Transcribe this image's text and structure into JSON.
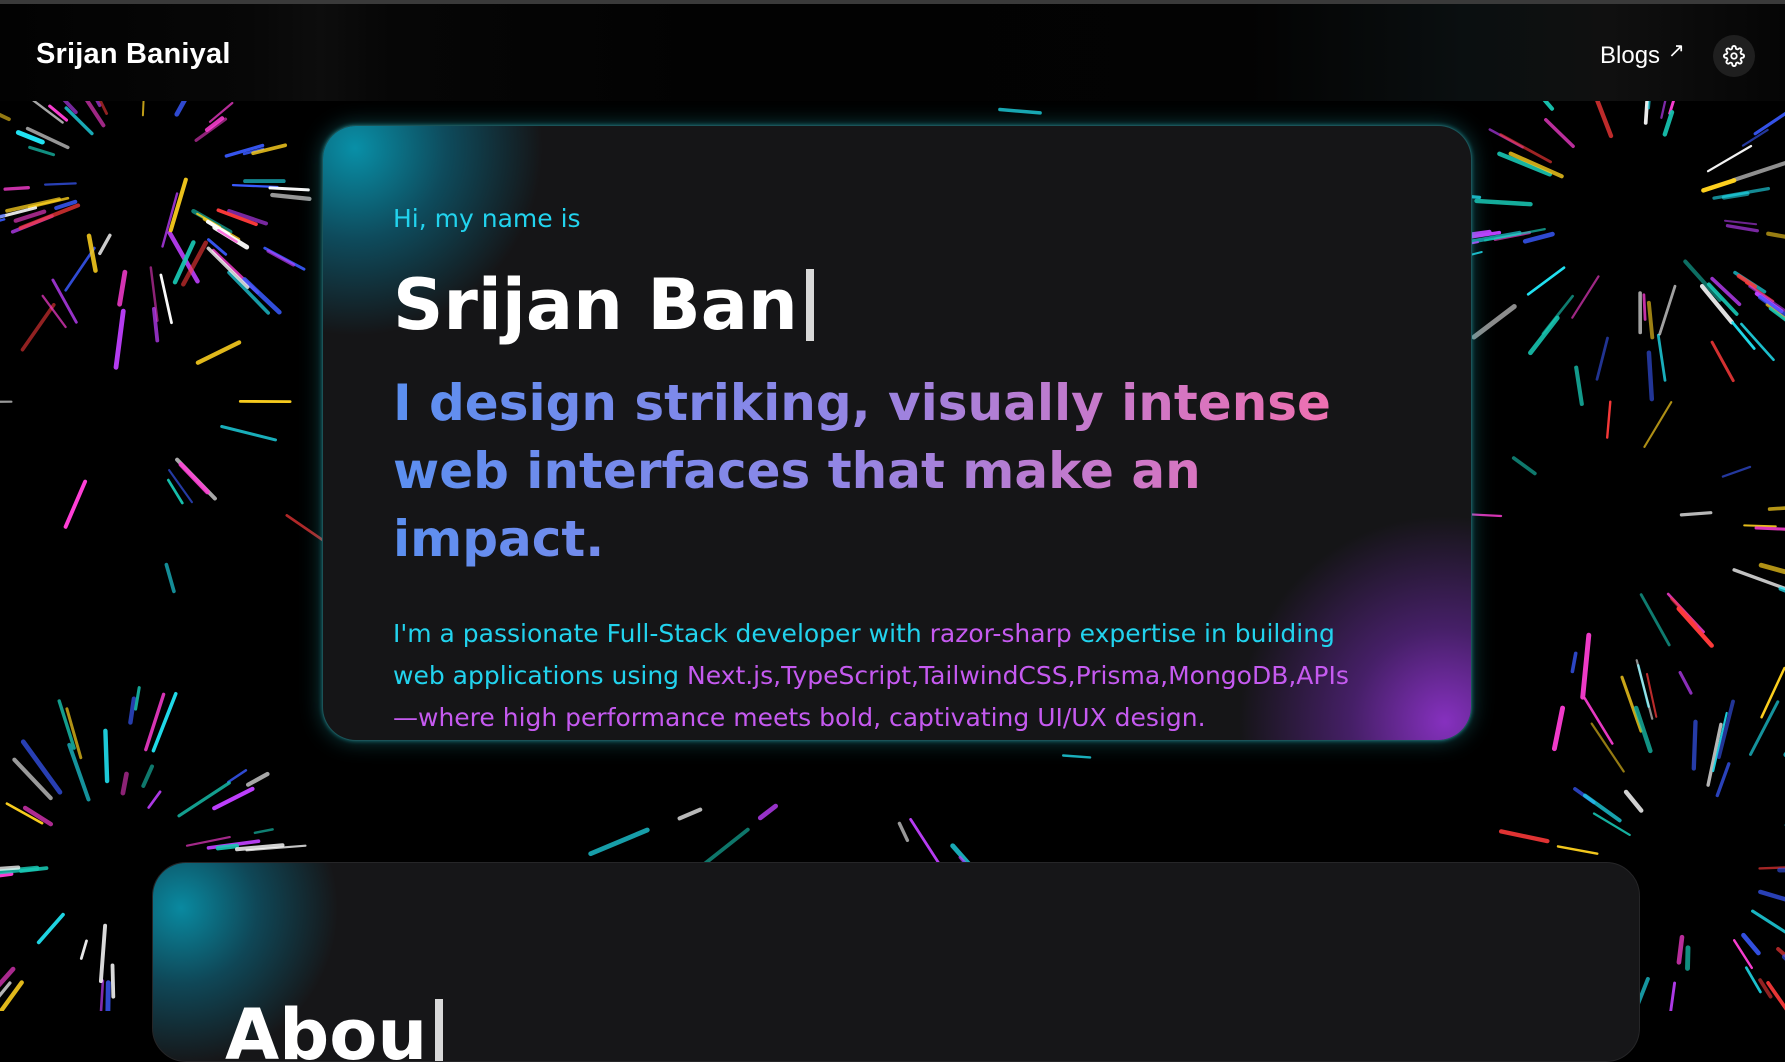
{
  "nav": {
    "brand": "Srijan Baniyal",
    "blogs_label": "Blogs",
    "blogs_icon": "↗",
    "settings_icon": "gear-icon"
  },
  "hero": {
    "greeting": "Hi, my name is",
    "name_typed": "Srijan Ban",
    "tagline": "I design striking, visually intense web interfaces that make an impact.",
    "intro": {
      "part1": "I'm a passionate Full-Stack developer with ",
      "highlight1": "razor-sharp",
      "part2": " expertise in building web applications using ",
      "highlight2": "Next.js,TypeScript,TailwindCSS,Prisma,MongoDB,APIs—where high performance meets bold, captivating UI/UX design."
    }
  },
  "about": {
    "heading_typed": "Abou"
  },
  "colors": {
    "accent_cyan": "#22d3ee",
    "accent_purple": "#c55af0",
    "tagline_start": "#5b8ff0",
    "tagline_end": "#f26fae",
    "card_bg": "#151517"
  }
}
